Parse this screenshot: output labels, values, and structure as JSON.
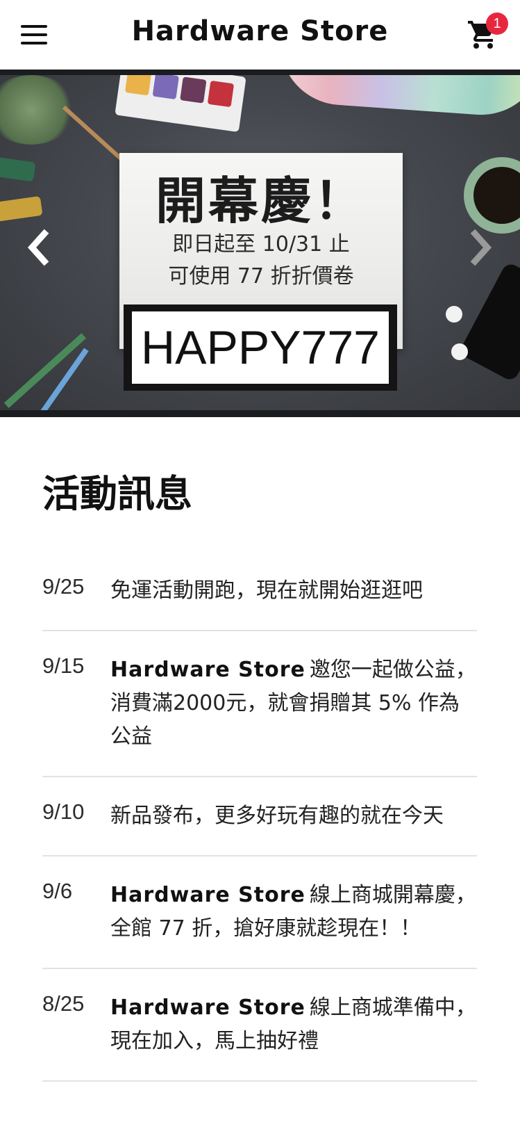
{
  "header": {
    "brand": "Hardware Store",
    "cart_count": "1",
    "icons": [
      "hamburger-menu-icon",
      "shopping-cart-icon"
    ]
  },
  "banner": {
    "title": "開幕慶！",
    "line1": "即日起至 10/31 止",
    "line2": "可使用 77 折折價卷",
    "coupon_code": "HAPPY777",
    "icons": [
      "chevron-left-icon",
      "chevron-right-icon"
    ]
  },
  "news": {
    "title": "活動訊息",
    "items": [
      {
        "date": "9/25",
        "brand": "",
        "text": "免運活動開跑，現在就開始逛逛吧"
      },
      {
        "date": "9/15",
        "brand": "Hardware Store",
        "text": "邀您一起做公益，消費滿2000元，就會捐贈其 5% 作為公益"
      },
      {
        "date": "9/10",
        "brand": "",
        "text": "新品發布，更多好玩有趣的就在今天"
      },
      {
        "date": "9/6",
        "brand": "Hardware Store",
        "text": "線上商城開幕慶，全館 77 折，搶好康就趁現在！！"
      },
      {
        "date": "8/25",
        "brand": "Hardware Store",
        "text": "線上商城準備中，現在加入，馬上抽好禮"
      }
    ]
  },
  "colors": {
    "badge": "#e8273f",
    "divider": "#e2e2e2",
    "banner_bg": "#45484e"
  }
}
